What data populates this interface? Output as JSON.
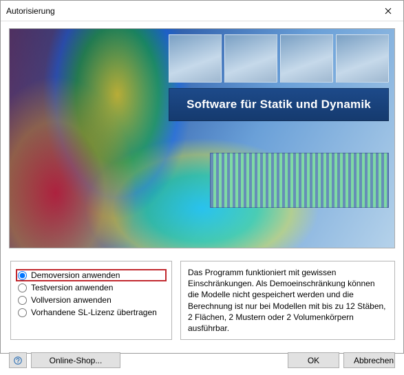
{
  "window": {
    "title": "Autorisierung"
  },
  "hero": {
    "tagline": "Software für Statik und Dynamik"
  },
  "options": {
    "items": [
      {
        "label": "Demoversion anwenden",
        "selected": true,
        "highlight": true
      },
      {
        "label": "Testversion anwenden",
        "selected": false,
        "highlight": false
      },
      {
        "label": "Vollversion anwenden",
        "selected": false,
        "highlight": false
      },
      {
        "label": "Vorhandene SL-Lizenz übertragen",
        "selected": false,
        "highlight": false
      }
    ]
  },
  "description": {
    "text": "Das Programm funktioniert mit gewissen Einschränkungen. Als Demoeinschränkung können die Modelle nicht gespeichert werden und die Berechnung ist nur bei Modellen mit bis zu 12 Stäben, 2 Flächen, 2 Mustern oder 2 Volumenkörpern ausführbar."
  },
  "footer": {
    "online_shop": "Online-Shop...",
    "ok": "OK",
    "cancel": "Abbrechen"
  }
}
